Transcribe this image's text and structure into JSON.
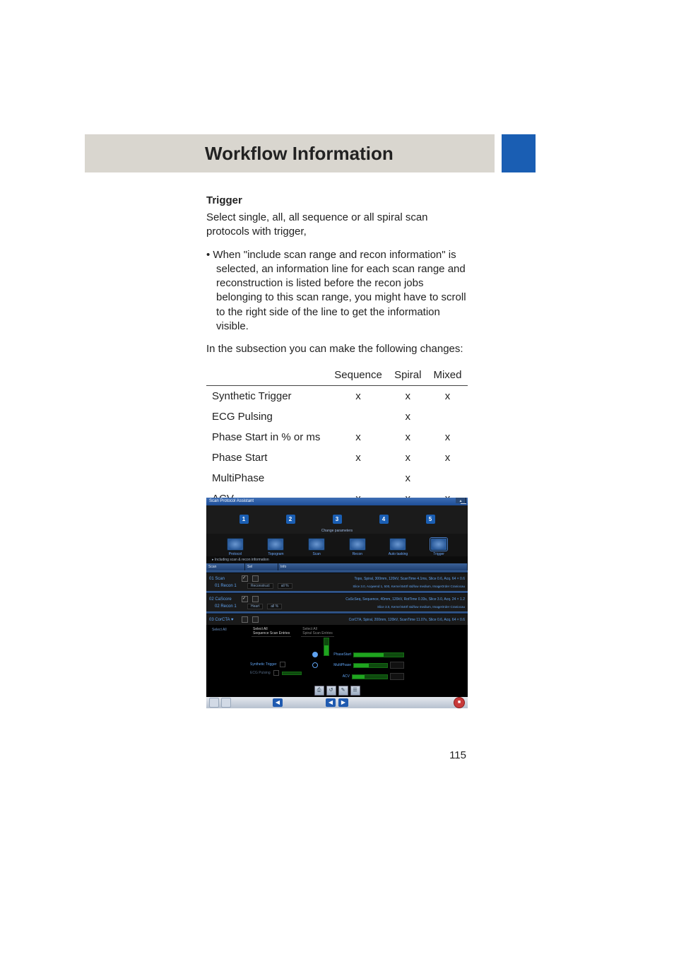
{
  "header": {
    "title": "Workflow Information"
  },
  "section": {
    "subhead": "Trigger",
    "intro": "Select single, all, all sequence or all spiral scan protocols with trigger,",
    "bullet": "When \"include scan range and recon information\" is selected, an information line for each scan range and reconstruction is listed before the recon jobs belonging to this scan range, you might have to scroll to the right side of the line to get the information visible.",
    "subsection_intro": "In the subsection you can make the following changes:"
  },
  "table": {
    "headers": [
      "",
      "Sequence",
      "Spiral",
      "Mixed"
    ],
    "rows": [
      {
        "label": "Synthetic Trigger",
        "seq": "x",
        "spi": "x",
        "mix": "x"
      },
      {
        "label": "ECG Pulsing",
        "seq": "",
        "spi": "x",
        "mix": ""
      },
      {
        "label": "Phase Start in % or ms",
        "seq": "x",
        "spi": "x",
        "mix": "x"
      },
      {
        "label": "Phase Start",
        "seq": "x",
        "spi": "x",
        "mix": "x"
      },
      {
        "label": "MultiPhase",
        "seq": "",
        "spi": "x",
        "mix": ""
      },
      {
        "label": "ACV",
        "seq": "x",
        "spi": "x",
        "mix": "x"
      }
    ]
  },
  "screenshot": {
    "window_title": "Scan Protocol Assistant",
    "wizard_subtitle": "Change parameters",
    "wizard_steps": [
      "1",
      "2",
      "3",
      "4",
      "5"
    ],
    "tabs": [
      {
        "label": "Protocol"
      },
      {
        "label": "Topogram"
      },
      {
        "label": "Scan"
      },
      {
        "label": "Recon"
      },
      {
        "label": "Auto tasking"
      },
      {
        "label": "Trigger"
      }
    ],
    "subbar_note": "Including scan & recon information",
    "grid_headers": [
      "Scan",
      "Sel",
      "Info"
    ],
    "rows": [
      {
        "label": "01 Scan",
        "sublabel": "01 Recon 1",
        "info_top": "Topo, Spiral, 300mm, 120kV, ScanTime 4.1ms, Slice 0.6, Acq. 64 × 0.6",
        "info_sub": "Slice 3.0, Acqwend 1, 500, Kernel B40f std/low medium, ImageOrder Craniocau",
        "subcell_a": "Reconstruct",
        "subcell_b": "all %"
      },
      {
        "label": "02 CaScore",
        "sublabel": "02 Recon 1",
        "info_top": "CaScSeq, Sequence, 40mm, 120kV, RotTime 0.33s, Slice 3.0, Acq. 24 × 1.2",
        "info_sub": "Slice 3.0, Kernel B40f std/low medium, ImageOrder Craniocau",
        "subcell_a": "Heart",
        "subcell_b": "all %"
      },
      {
        "label": "03 CorCTA ♥",
        "sublabel": "",
        "info_top": "CorCTA, Spiral, 200mm, 120kV, ScanTime 11.07s, Slice 0.6, Acq. 64 × 0.6",
        "info_sub": "",
        "subcell_a": "",
        "subcell_b": ""
      }
    ],
    "select_all_label": "Select All",
    "scan_subtabs": [
      {
        "label": "Select All",
        "sub": "Sequence Scan Entries"
      },
      {
        "label": "Select All",
        "sub": "Spiral Scan Entries"
      }
    ],
    "sliders": {
      "vertical_label": "%",
      "phase_start": "PhaseStart",
      "multiphase": "MultiPhase",
      "acv": "ACV",
      "synthetic_trigger": "Synthetic Trigger",
      "ecg_pulsing": "ECG Pulsing"
    },
    "footer": {
      "back": "◀",
      "prev": "◀",
      "next": "▶",
      "stop": "■"
    }
  },
  "page_number": "115"
}
